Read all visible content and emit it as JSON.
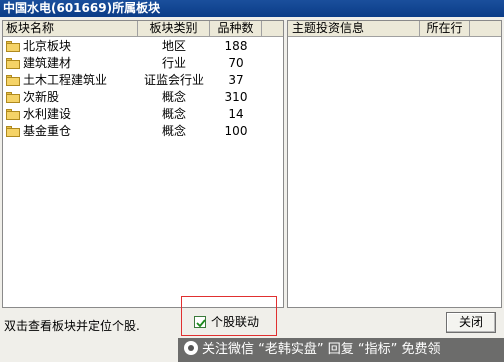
{
  "window": {
    "title": "中国水电(601669)所属板块"
  },
  "left_table": {
    "columns": [
      "板块名称",
      "板块类别",
      "品种数"
    ],
    "rows": [
      {
        "name": "北京板块",
        "category": "地区",
        "count": "188"
      },
      {
        "name": "建筑建材",
        "category": "行业",
        "count": "70"
      },
      {
        "name": "土木工程建筑业",
        "category": "证监会行业",
        "count": "37"
      },
      {
        "name": "次新股",
        "category": "概念",
        "count": "310"
      },
      {
        "name": "水利建设",
        "category": "概念",
        "count": "14"
      },
      {
        "name": "基金重仓",
        "category": "概念",
        "count": "100"
      }
    ]
  },
  "right_table": {
    "columns": [
      "主题投资信息",
      "所在行"
    ]
  },
  "footer": {
    "status_text": "双击查看板块并定位个股.",
    "checkbox_label": "个股联动",
    "checkbox_checked": true,
    "close_label": "关闭"
  },
  "watermark": {
    "text": "关注微信 “老韩实盘” 回复 “指标” 免费领"
  },
  "colors": {
    "title_bar": "#0b3c87",
    "highlight_box": "#e03030",
    "folder": "#f5d367"
  }
}
